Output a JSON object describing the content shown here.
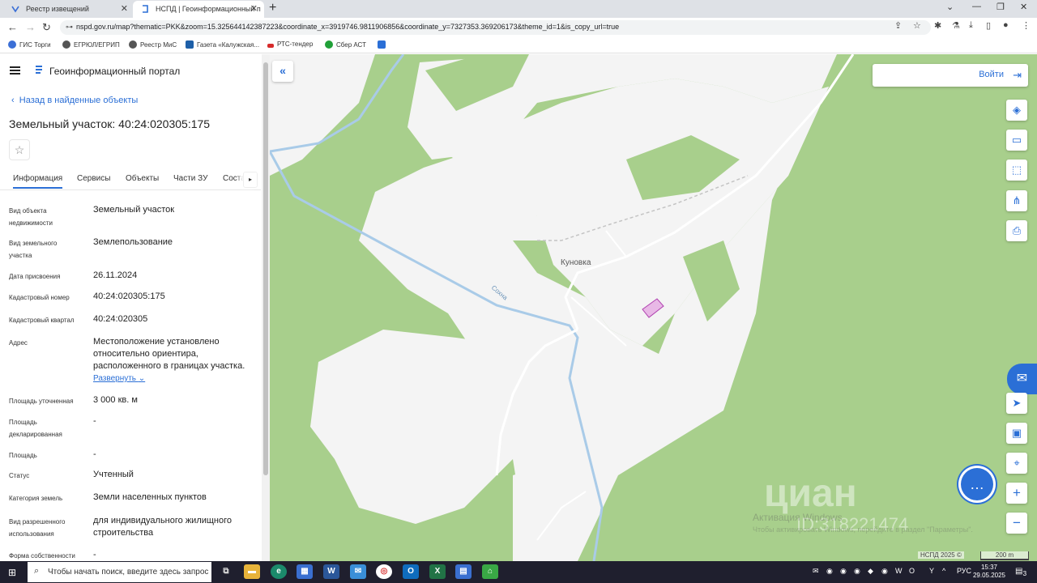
{
  "browser": {
    "tabs": [
      {
        "title": "Реестр извещений"
      },
      {
        "title": "НСПД | Геоинформационный п"
      }
    ],
    "url": "nspd.gov.ru/map?thematic=PKK&zoom=15.325644142387223&coordinate_x=3919746.9811906856&coordinate_y=7327353.369206173&theme_id=1&is_copy_url=true",
    "bookmarks": [
      {
        "label": "ГИС Торги",
        "color": "#3b6fd6"
      },
      {
        "label": "ЕГРЮЛ/ЕГРИП",
        "color": "#555555"
      },
      {
        "label": "Реестр МиС",
        "color": "#555555"
      },
      {
        "label": "Газета «Калужская...",
        "color": "#1e5fa8"
      },
      {
        "label": "РТС-тендер",
        "color": "#d62b2b"
      },
      {
        "label": "Сбер АСТ",
        "color": "#21a038"
      }
    ]
  },
  "panel": {
    "portal_title": "Геоинформационный портал",
    "back_label": "Назад в найденные объекты",
    "heading": "Земельный участок: 40:24:020305:175",
    "tabs": [
      "Информация",
      "Сервисы",
      "Объекты",
      "Части ЗУ",
      "Соста"
    ],
    "fields": [
      {
        "label": "Вид объекта недвижимости",
        "value": "Земельный участок"
      },
      {
        "label": "Вид земельного участка",
        "value": "Землепользование"
      },
      {
        "label": "Дата присвоения",
        "value": "26.11.2024"
      },
      {
        "label": "Кадастровый номер",
        "value": "40:24:020305:175"
      },
      {
        "label": "Кадастровый квартал",
        "value": "40:24:020305"
      },
      {
        "label": "Адрес",
        "value": "Местоположение установлено относительно ориентира, расположенного в границах участка."
      },
      {
        "label": "Площадь уточненная",
        "value": "3 000 кв. м"
      },
      {
        "label": "Площадь декларированная",
        "value": "-"
      },
      {
        "label": "Площадь",
        "value": "-"
      },
      {
        "label": "Статус",
        "value": "Учтенный"
      },
      {
        "label": "Категория земель",
        "value": "Земли населенных пунктов"
      },
      {
        "label": "Вид разрешенного использования",
        "value": "для индивидуального жилищного строительства"
      },
      {
        "label": "Форма собственности",
        "value": "-"
      }
    ],
    "expand_label": "Развернуть"
  },
  "map": {
    "login_label": "Войти",
    "village_label": "Куновка",
    "river_label": "Сохна",
    "watermark": "циан",
    "watermark_id": "ID:318221474",
    "activation_title": "Активация Windows",
    "activation_sub": "Чтобы активировать Windows, перейдите в раздел \"Параметры\".",
    "attribution": "НСПД 2025 ©",
    "scale_label": "200 m",
    "colors": {
      "forest": "#a8cf8c",
      "open": "#f4f4f4",
      "river": "#a9cbe8",
      "parcel": "#e8b8e6",
      "accent": "#2b6fd6"
    }
  },
  "taskbar": {
    "search_placeholder": "Чтобы начать поиск, введите здесь запрос",
    "lang": "РУС",
    "time": "15:37",
    "date": "29.05.2025",
    "notifications": "3"
  }
}
